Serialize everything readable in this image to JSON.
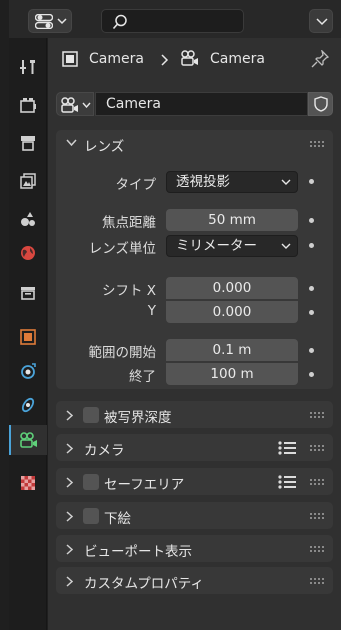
{
  "context": {
    "object_label": "Camera",
    "data_label": "Camera"
  },
  "datablock": {
    "name": "Camera"
  },
  "lens_panel": {
    "title": "レンズ",
    "type_label": "タイプ",
    "type_value": "透視投影",
    "focal_label": "焦点距離",
    "focal_value": "50 mm",
    "unit_label": "レンズ単位",
    "unit_value": "ミリメーター",
    "shift_x_label": "シフト X",
    "shift_x_value": "0.000",
    "shift_y_label": "Y",
    "shift_y_value": "0.000",
    "clip_start_label": "範囲の開始",
    "clip_start_value": "0.1 m",
    "clip_end_label": "終了",
    "clip_end_value": "100 m"
  },
  "panels": {
    "dof": "被写界深度",
    "camera": "カメラ",
    "safe_areas": "セーフエリア",
    "background": "下絵",
    "viewport_display": "ビューポート表示",
    "custom_props": "カスタムプロパティ"
  },
  "colors": {
    "accent": "#4aa3d9",
    "object_orange": "#e07b39",
    "camera_green": "#5fd17a",
    "world_red": "#d9473f",
    "texture_red": "#c23a3a"
  }
}
